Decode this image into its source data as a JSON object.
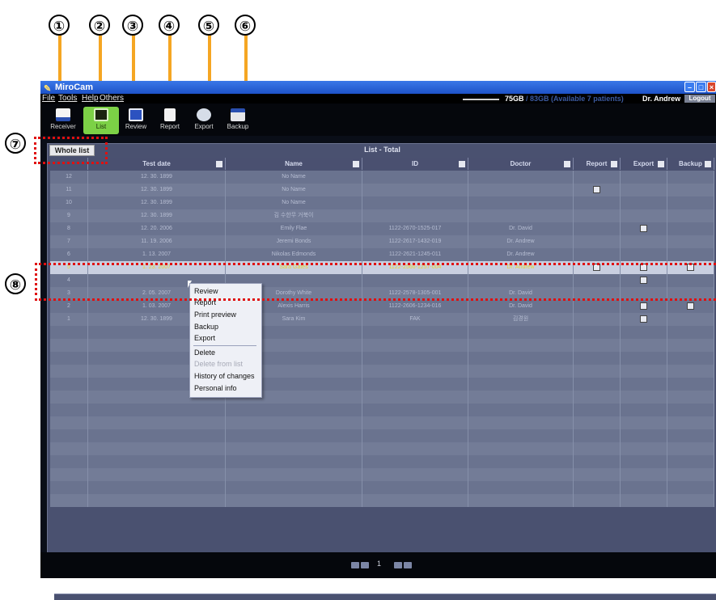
{
  "callouts": [
    "①",
    "②",
    "③",
    "④",
    "⑤",
    "⑥",
    "⑦",
    "⑧"
  ],
  "window": {
    "title": "MiroCam",
    "menu": [
      "File",
      "Tools",
      "Help",
      "Others"
    ],
    "storage_used": "75GB",
    "storage_rest": " / 83GB (Available 7 patients)",
    "storage_used_fraction": 0.9,
    "user": "Dr. Andrew",
    "logout_label": "Logout"
  },
  "toolbar": [
    {
      "label": "Receiver",
      "icon": "receiver-icon"
    },
    {
      "label": "List",
      "icon": "list-icon"
    },
    {
      "label": "Review",
      "icon": "review-icon"
    },
    {
      "label": "Report",
      "icon": "report-icon"
    },
    {
      "label": "Export",
      "icon": "export-icon"
    },
    {
      "label": "Backup",
      "icon": "backup-icon"
    }
  ],
  "list": {
    "whole_list_label": "Whole list",
    "title": "List - Total",
    "columns": [
      "",
      "Test date",
      "Name",
      "ID",
      "Doctor",
      "Report",
      "Export",
      "Backup"
    ],
    "rows": [
      {
        "no": "12",
        "date": "12. 30. 1899",
        "name": "No Name",
        "id": "",
        "doctor": "",
        "report": false,
        "export": false,
        "backup": false
      },
      {
        "no": "11",
        "date": "12. 30. 1899",
        "name": "No Name",
        "id": "",
        "doctor": "",
        "report": true,
        "export": false,
        "backup": false
      },
      {
        "no": "10",
        "date": "12. 30. 1899",
        "name": "No Name",
        "id": "",
        "doctor": "",
        "report": false,
        "export": false,
        "backup": false
      },
      {
        "no": "9",
        "date": "12. 30. 1899",
        "name": "김 수한무 거북이",
        "id": "",
        "doctor": "",
        "report": false,
        "export": false,
        "backup": false
      },
      {
        "no": "8",
        "date": "12. 20. 2006",
        "name": "Emily  Flae",
        "id": "1122-2670-1525-017",
        "doctor": "Dr. David",
        "report": false,
        "export": true,
        "backup": false
      },
      {
        "no": "7",
        "date": "11. 19. 2006",
        "name": "Jeremi  Bonds",
        "id": "1122-2617-1432-019",
        "doctor": "Dr. Andrew",
        "report": false,
        "export": false,
        "backup": false
      },
      {
        "no": "6",
        "date": "1. 13. 2007",
        "name": "Nikolas  Edmonds",
        "id": "1122-2621-1245-011",
        "doctor": "Dr. Andrew",
        "report": false,
        "export": false,
        "backup": false
      },
      {
        "no": "5",
        "date": "1. 23. 2007",
        "name": "Sara  Gates",
        "id": "1122-2566-1257-004",
        "doctor": "Dr. Andrew",
        "report": true,
        "export": true,
        "backup": true
      },
      {
        "no": "4",
        "date": "",
        "name": "",
        "id": "",
        "doctor": "",
        "report": false,
        "export": true,
        "backup": false
      },
      {
        "no": "3",
        "date": "2. 05. 2007",
        "name": "Dorothy  White",
        "id": "1122-2578-1305-001",
        "doctor": "Dr. David",
        "report": false,
        "export": false,
        "backup": false
      },
      {
        "no": "2",
        "date": "1. 03. 2007",
        "name": "Alexis  Harris",
        "id": "1122-2606-1234-016",
        "doctor": "Dr. David",
        "report": false,
        "export": true,
        "backup": true
      },
      {
        "no": "1",
        "date": "12. 30. 1899",
        "name": "Sara Kim",
        "id": "FAK",
        "doctor": "김경원",
        "report": false,
        "export": true,
        "backup": false
      }
    ],
    "selected_row": 7
  },
  "context_menu": [
    {
      "label": "Review",
      "disabled": false
    },
    {
      "label": "Report",
      "disabled": false
    },
    {
      "label": "Print preview",
      "disabled": false
    },
    {
      "label": "Backup",
      "disabled": false
    },
    {
      "label": "Export",
      "disabled": false
    },
    {
      "label": "Delete",
      "disabled": false
    },
    {
      "label": "Delete from list",
      "disabled": true
    },
    {
      "label": "History of changes",
      "disabled": false
    },
    {
      "label": "Personal info",
      "disabled": false
    }
  ],
  "pager": {
    "page": "1"
  }
}
